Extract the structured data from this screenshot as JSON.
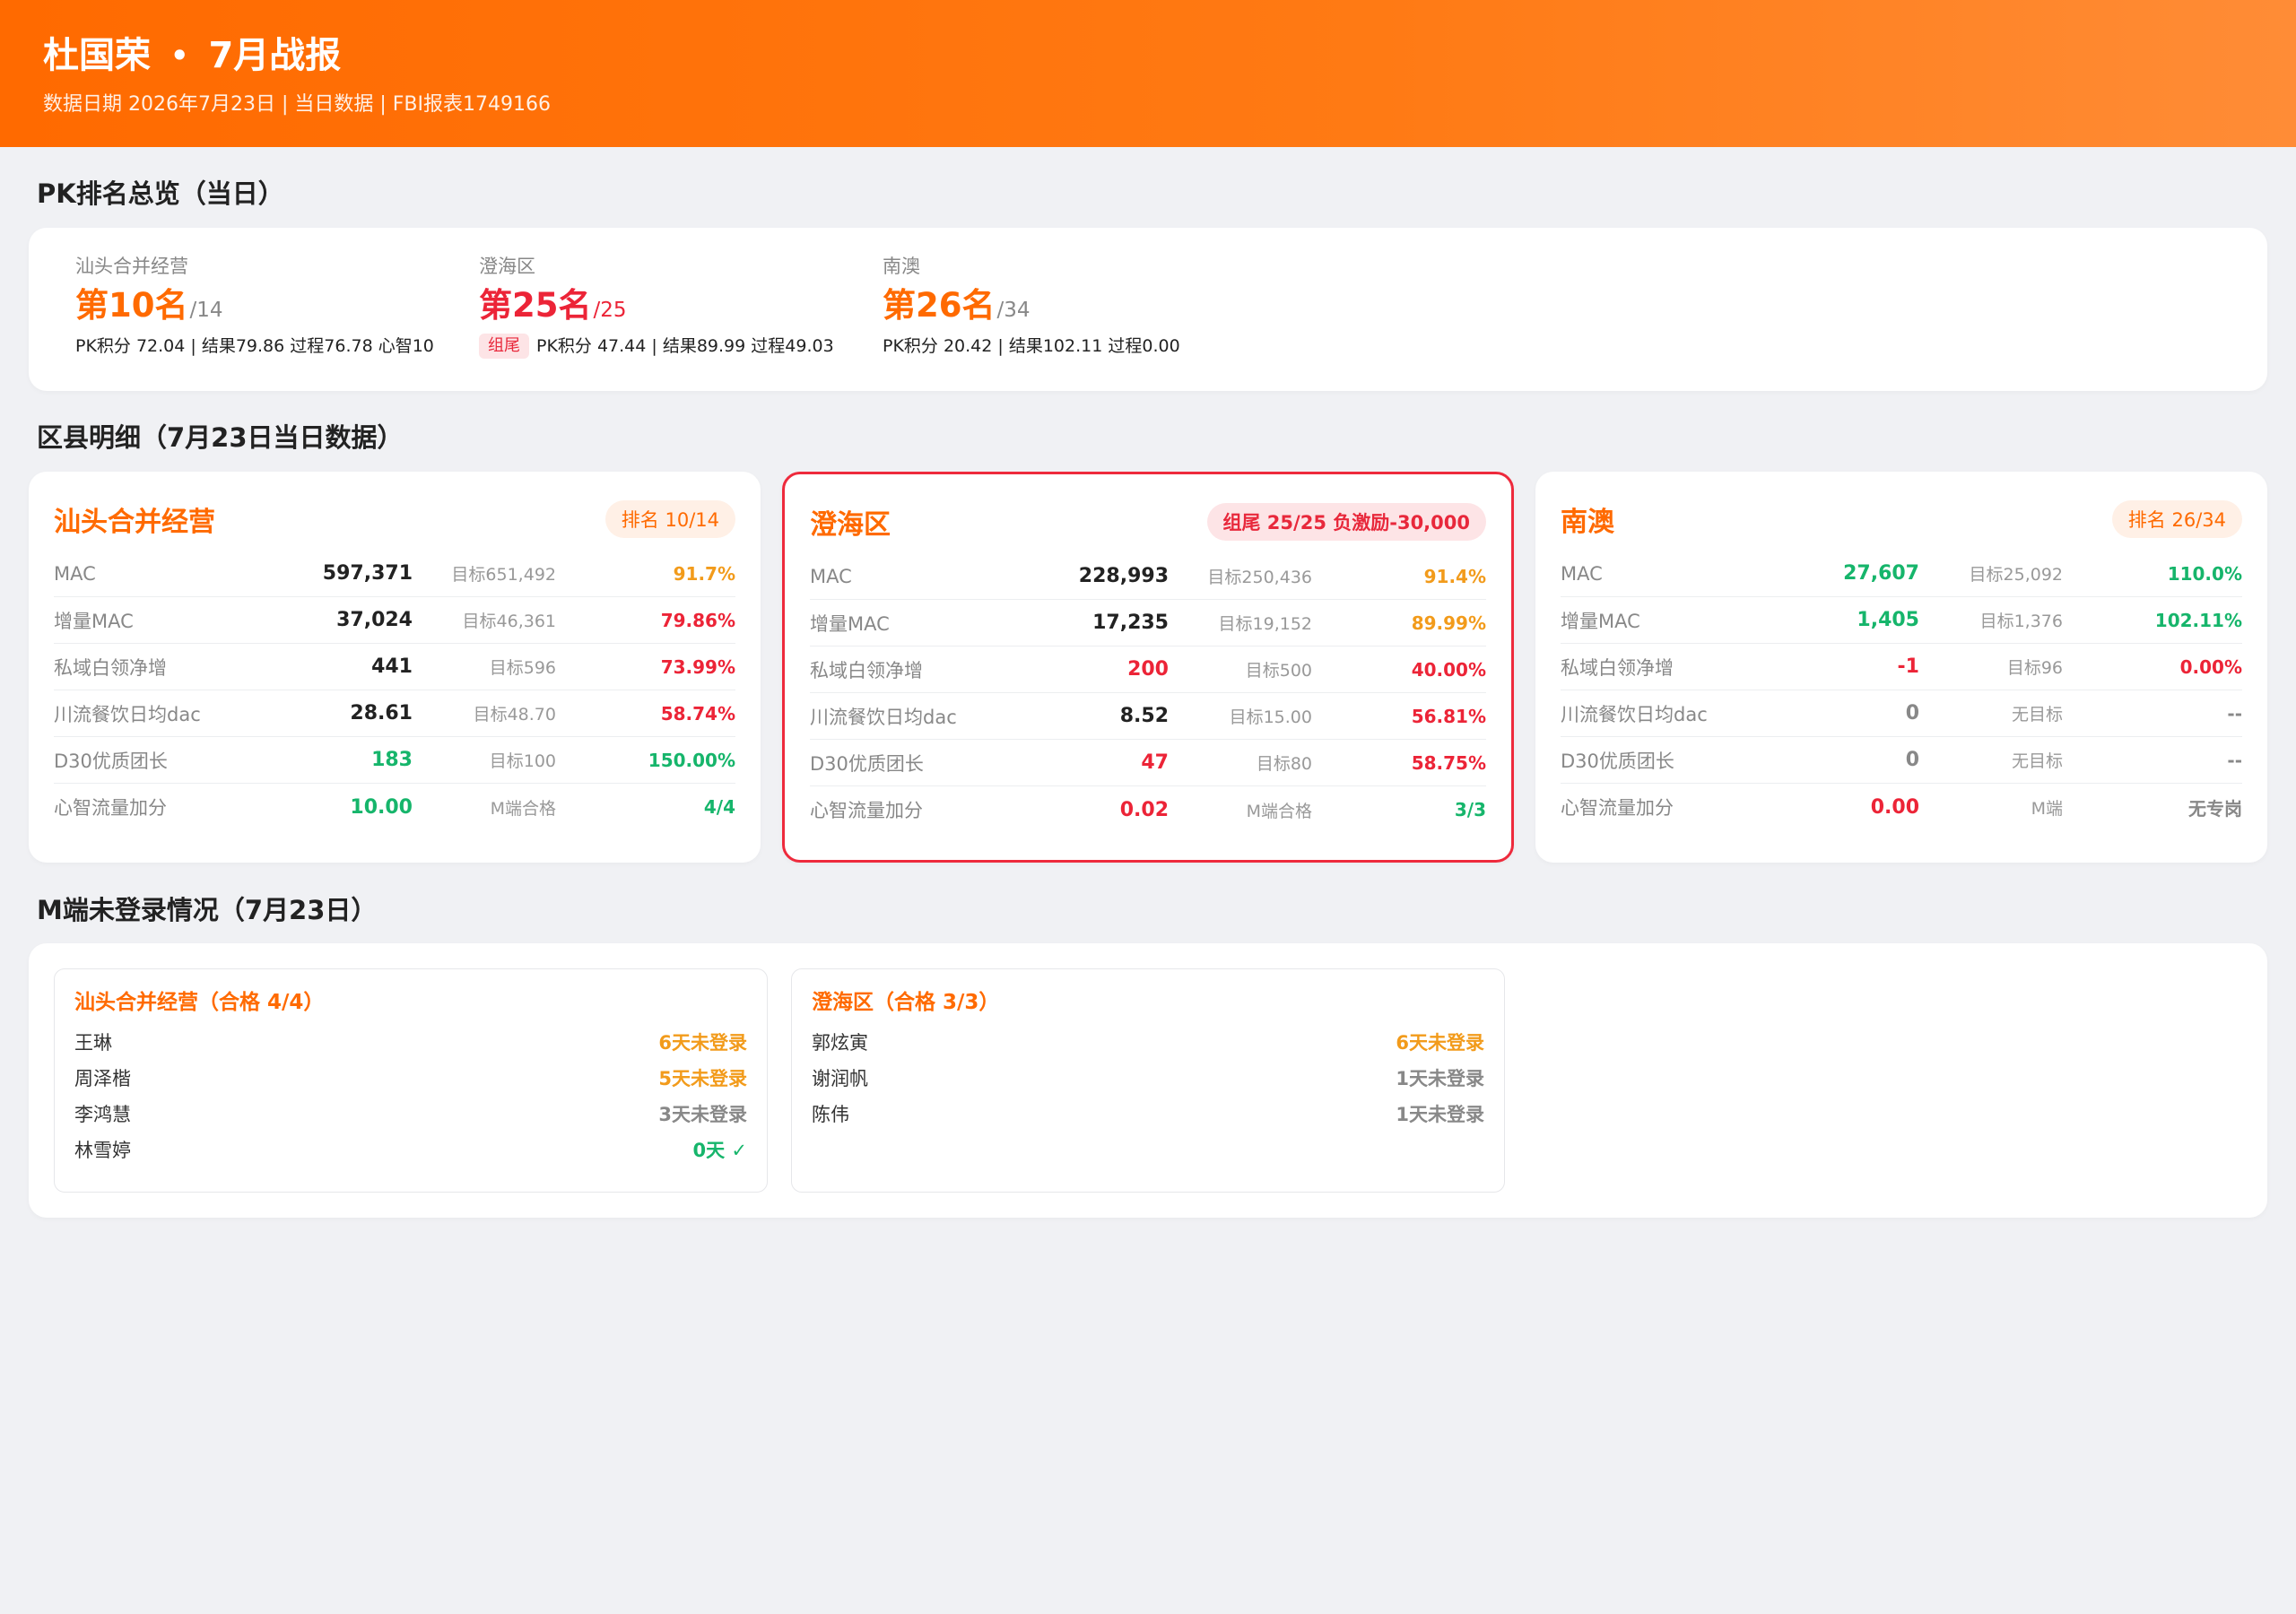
{
  "header": {
    "name": "杜国荣",
    "dot": "•",
    "report": "7月战报",
    "subtitle": "数据日期 2026年7月23日 | 当日数据 | FBI报表1749166"
  },
  "sections": {
    "pk_title": "PK排名总览（当日）",
    "district_title": "区县明细（7月23日当日数据）",
    "login_title": "M端未登录情况（7月23日）"
  },
  "pk": [
    {
      "name": "汕头合并经营",
      "rank": "第10名",
      "total": "/14",
      "tag": "",
      "detail": "PK积分 72.04 | 结果79.86 过程76.78 心智10",
      "color": "#ff6a00"
    },
    {
      "name": "澄海区",
      "rank": "第25名",
      "total": "/25",
      "tag": "组尾",
      "detail": "PK积分 47.44 | 结果89.99 过程49.03",
      "color": "#ec2437"
    },
    {
      "name": "南澳",
      "rank": "第26名",
      "total": "/34",
      "tag": "",
      "detail": "PK积分 20.42 | 结果102.11 过程0.00",
      "color": "#ff6a00"
    }
  ],
  "districts": [
    {
      "name": "汕头合并经营",
      "badge": "排名 10/14",
      "rows": [
        {
          "label": "MAC",
          "value": "597,371",
          "target": "目标651,492",
          "pct": "91.7%",
          "vc": "dark",
          "pc": "orange"
        },
        {
          "label": "增量MAC",
          "value": "37,024",
          "target": "目标46,361",
          "pct": "79.86%",
          "vc": "dark",
          "pc": "red"
        },
        {
          "label": "私域白领净增",
          "value": "441",
          "target": "目标596",
          "pct": "73.99%",
          "vc": "dark",
          "pc": "red"
        },
        {
          "label": "川流餐饮日均dac",
          "value": "28.61",
          "target": "目标48.70",
          "pct": "58.74%",
          "vc": "dark",
          "pc": "red"
        },
        {
          "label": "D30优质团长",
          "value": "183",
          "target": "目标100",
          "pct": "150.00%",
          "vc": "green",
          "pc": "green"
        },
        {
          "label": "心智流量加分",
          "value": "10.00",
          "target": "M端合格",
          "pct": "4/4",
          "vc": "green",
          "pc": "green"
        }
      ]
    },
    {
      "name": "澄海区",
      "badge": "组尾 25/25 负激励-30,000",
      "rows": [
        {
          "label": "MAC",
          "value": "228,993",
          "target": "目标250,436",
          "pct": "91.4%",
          "vc": "dark",
          "pc": "orange"
        },
        {
          "label": "增量MAC",
          "value": "17,235",
          "target": "目标19,152",
          "pct": "89.99%",
          "vc": "dark",
          "pc": "orange"
        },
        {
          "label": "私域白领净增",
          "value": "200",
          "target": "目标500",
          "pct": "40.00%",
          "vc": "red",
          "pc": "red"
        },
        {
          "label": "川流餐饮日均dac",
          "value": "8.52",
          "target": "目标15.00",
          "pct": "56.81%",
          "vc": "dark",
          "pc": "red"
        },
        {
          "label": "D30优质团长",
          "value": "47",
          "target": "目标80",
          "pct": "58.75%",
          "vc": "red",
          "pc": "red"
        },
        {
          "label": "心智流量加分",
          "value": "0.02",
          "target": "M端合格",
          "pct": "3/3",
          "vc": "red",
          "pc": "green"
        }
      ]
    },
    {
      "name": "南澳",
      "badge": "排名 26/34",
      "rows": [
        {
          "label": "MAC",
          "value": "27,607",
          "target": "目标25,092",
          "pct": "110.0%",
          "vc": "green",
          "pc": "green"
        },
        {
          "label": "增量MAC",
          "value": "1,405",
          "target": "目标1,376",
          "pct": "102.11%",
          "vc": "green",
          "pc": "green"
        },
        {
          "label": "私域白领净增",
          "value": "-1",
          "target": "目标96",
          "pct": "0.00%",
          "vc": "red",
          "pc": "red"
        },
        {
          "label": "川流餐饮日均dac",
          "value": "0",
          "target": "无目标",
          "pct": "--",
          "vc": "gray",
          "pc": "gray"
        },
        {
          "label": "D30优质团长",
          "value": "0",
          "target": "无目标",
          "pct": "--",
          "vc": "gray",
          "pc": "gray"
        },
        {
          "label": "心智流量加分",
          "value": "0.00",
          "target": "M端",
          "pct": "无专岗",
          "vc": "red",
          "pc": "gray"
        }
      ]
    }
  ],
  "logins": [
    {
      "title": "汕头合并经营（合格 4/4）",
      "rows": [
        {
          "name": "王琳",
          "status": "6天未登录",
          "c": "orange"
        },
        {
          "name": "周泽楷",
          "status": "5天未登录",
          "c": "orange"
        },
        {
          "name": "李鸿慧",
          "status": "3天未登录",
          "c": "gray"
        },
        {
          "name": "林雪婷",
          "status": "0天 ✓",
          "c": "green"
        }
      ]
    },
    {
      "title": "澄海区（合格 3/3）",
      "rows": [
        {
          "name": "郭炫寅",
          "status": "6天未登录",
          "c": "orange"
        },
        {
          "name": "谢润帆",
          "status": "1天未登录",
          "c": "gray"
        },
        {
          "name": "陈伟",
          "status": "1天未登录",
          "c": "gray"
        }
      ]
    }
  ]
}
